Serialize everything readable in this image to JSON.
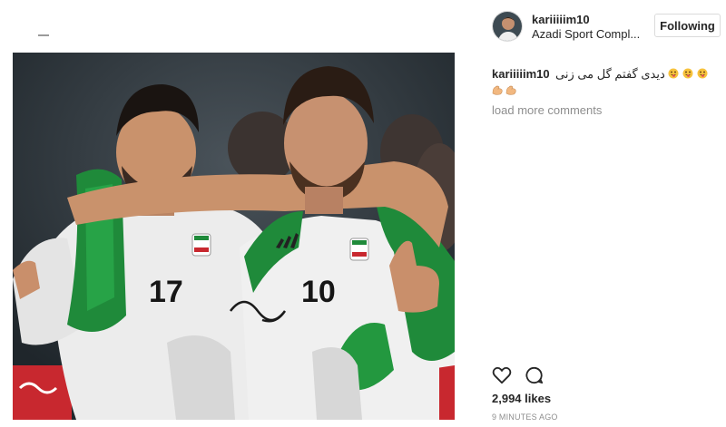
{
  "post": {
    "username": "kariiiiim10",
    "location": "Azadi Sport Compl...",
    "follow_label": "Following",
    "comment": {
      "username": "kariiiiim10",
      "text": "دیدی گفتم گل می زنی",
      "emojis": [
        "face-with-tongue-emoji",
        "face-with-tongue-emoji",
        "face-with-tongue-emoji",
        "flexed-biceps-emoji",
        "flexed-biceps-emoji"
      ]
    },
    "load_more_label": "load more comments",
    "likes_text": "2,994 likes",
    "timestamp": "9 MINUTES AGO",
    "icons": {
      "like": "heart-icon",
      "comment": "comment-bubble-icon"
    }
  },
  "photo": {
    "jersey_numbers": [
      "17",
      "10"
    ],
    "description_colors": {
      "jersey": "#ececec",
      "flag_green": "#1f8a3a",
      "flag_red": "#c8282f",
      "background": "#2b3238"
    }
  }
}
